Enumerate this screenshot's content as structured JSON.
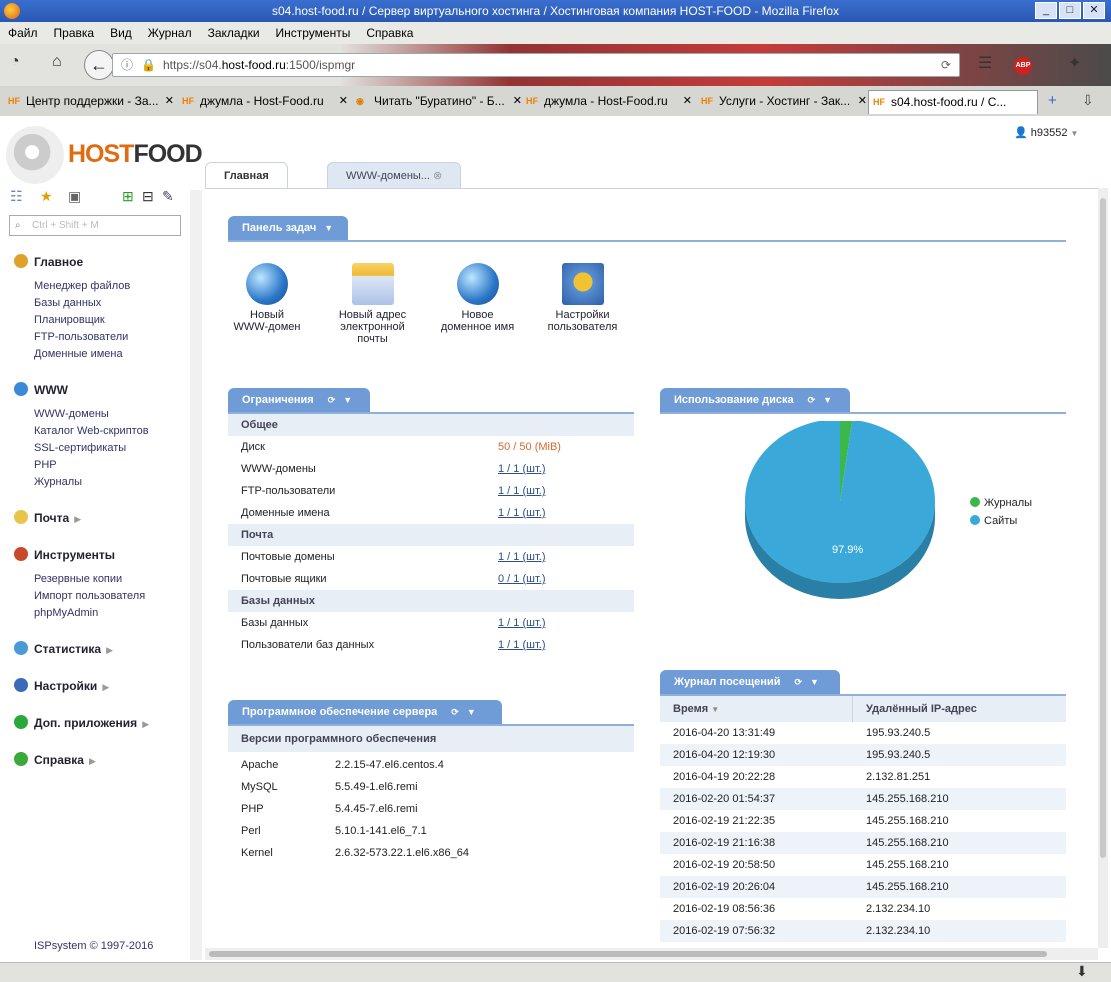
{
  "window": {
    "title": "s04.host-food.ru / Сервер виртуального хостинга / Хостинговая компания HOST-FOOD - Mozilla Firefox",
    "controls": [
      "_",
      "□",
      "✕"
    ]
  },
  "menu": [
    "Файл",
    "Правка",
    "Вид",
    "Журнал",
    "Закладки",
    "Инструменты",
    "Справка"
  ],
  "url": {
    "prefix": "https://s04.",
    "host": "host-food.ru",
    "suffix": ":1500/ispmgr"
  },
  "browser_tabs": [
    {
      "label": "Центр поддержки - За...",
      "icon": "hf-favicon",
      "close": "✕"
    },
    {
      "label": "джумла - Host-Food.ru",
      "icon": "hf-favicon",
      "close": "✕"
    },
    {
      "label": "Читать \"Буратино\" - Б...",
      "icon": "book-favicon",
      "close": "✕"
    },
    {
      "label": "джумла - Host-Food.ru",
      "icon": "hf-favicon",
      "close": "✕"
    },
    {
      "label": "Услуги - Хостинг - Зак...",
      "icon": "hf-favicon",
      "close": "✕"
    },
    {
      "label": "s04.host-food.ru / С...",
      "icon": "hf-favicon",
      "close": "✕"
    }
  ],
  "user": "h93552",
  "logo": {
    "a": "HOST",
    "b": "FOOD"
  },
  "search_placeholder": "Ctrl + Shift + M",
  "sidebar": {
    "groups": [
      {
        "label": "Главное",
        "color": "#e0a02a",
        "items": [
          "Менеджер файлов",
          "Базы данных",
          "Планировщик",
          "FTP-пользователи",
          "Доменные имена"
        ]
      },
      {
        "label": "WWW",
        "color": "#3a8ad8",
        "items": [
          "WWW-домены",
          "Каталог Web-скриптов",
          "SSL-сертификаты",
          "PHP",
          "Журналы"
        ]
      },
      {
        "label": "Почта",
        "color": "#e8c44a",
        "items": []
      },
      {
        "label": "Инструменты",
        "color": "#c84a2a",
        "items": [
          "Резервные копии",
          "Импорт пользователя",
          "phpMyAdmin"
        ]
      },
      {
        "label": "Статистика",
        "color": "#4a9ad8",
        "items": []
      },
      {
        "label": "Настройки",
        "color": "#3a6ab8",
        "items": []
      },
      {
        "label": "Доп. приложения",
        "color": "#2aa83a",
        "items": []
      },
      {
        "label": "Справка",
        "color": "#3aa83a",
        "items": []
      }
    ],
    "copyright": "ISPsystem © 1997-2016"
  },
  "page_tabs": [
    {
      "label": "Главная"
    },
    {
      "label": "WWW-домены...",
      "close": "⊗"
    }
  ],
  "taskpanel": {
    "title": "Панель задач",
    "items": [
      {
        "label": "Новый\nWWW-домен",
        "icon": "globe-icon"
      },
      {
        "label": "Новый адрес\nэлектронной\nпочты",
        "icon": "mail-icon"
      },
      {
        "label": "Новое\nдоменное имя",
        "icon": "globe-tag-icon"
      },
      {
        "label": "Настройки\nпользователя",
        "icon": "settings-icon"
      }
    ]
  },
  "limits": {
    "title": "Ограничения",
    "sections": [
      {
        "name": "Общее",
        "rows": [
          {
            "label": "Диск",
            "value": "50 / 50 (MiB)",
            "warn": true
          },
          {
            "label": "WWW-домены",
            "value": "1 / 1 (шт.)"
          },
          {
            "label": "FTP-пользователи",
            "value": "1 / 1 (шт.)"
          },
          {
            "label": "Доменные имена",
            "value": "1 / 1 (шт.)"
          }
        ]
      },
      {
        "name": "Почта",
        "rows": [
          {
            "label": "Почтовые домены",
            "value": "1 / 1 (шт.)"
          },
          {
            "label": "Почтовые ящики",
            "value": "0 / 1 (шт.)"
          }
        ]
      },
      {
        "name": "Базы данных",
        "rows": [
          {
            "label": "Базы данных",
            "value": "1 / 1 (шт.)"
          },
          {
            "label": "Пользователи баз данных",
            "value": "1 / 1 (шт.)"
          }
        ]
      }
    ]
  },
  "software": {
    "title": "Программное обеспечение сервера",
    "header": "Версии программного обеспечения",
    "rows": [
      {
        "name": "Apache",
        "version": "2.2.15-47.el6.centos.4"
      },
      {
        "name": "MySQL",
        "version": "5.5.49-1.el6.remi"
      },
      {
        "name": "PHP",
        "version": "5.4.45-7.el6.remi"
      },
      {
        "name": "Perl",
        "version": "5.10.1-141.el6_7.1"
      },
      {
        "name": "Kernel",
        "version": "2.6.32-573.22.1.el6.x86_64"
      }
    ]
  },
  "disk": {
    "title": "Использование диска",
    "label": "97.9%",
    "legend": [
      "Журналы",
      "Сайты"
    ]
  },
  "chart_data": {
    "type": "pie",
    "title": "Использование диска",
    "series": [
      {
        "name": "Журналы",
        "value": 2.1,
        "color": "#3cb84a"
      },
      {
        "name": "Сайты",
        "value": 97.9,
        "color": "#3aa8d8"
      }
    ],
    "data_label": "97.9%",
    "legend": "right"
  },
  "visits": {
    "title": "Журнал посещений",
    "col_time": "Время",
    "col_ip": "Удалённый IP-адрес",
    "rows": [
      {
        "time": "2016-04-20 13:31:49",
        "ip": "195.93.240.5"
      },
      {
        "time": "2016-04-20 12:19:30",
        "ip": "195.93.240.5"
      },
      {
        "time": "2016-04-19 20:22:28",
        "ip": "2.132.81.251"
      },
      {
        "time": "2016-02-20 01:54:37",
        "ip": "145.255.168.210"
      },
      {
        "time": "2016-02-19 21:22:35",
        "ip": "145.255.168.210"
      },
      {
        "time": "2016-02-19 21:16:38",
        "ip": "145.255.168.210"
      },
      {
        "time": "2016-02-19 20:58:50",
        "ip": "145.255.168.210"
      },
      {
        "time": "2016-02-19 20:26:04",
        "ip": "145.255.168.210"
      },
      {
        "time": "2016-02-19 08:56:36",
        "ip": "2.132.234.10"
      },
      {
        "time": "2016-02-19 07:56:32",
        "ip": "2.132.234.10"
      }
    ]
  },
  "icons": {
    "refresh": "⟳",
    "dropdown": "▼",
    "sort": "▼",
    "reload": "⟳"
  }
}
